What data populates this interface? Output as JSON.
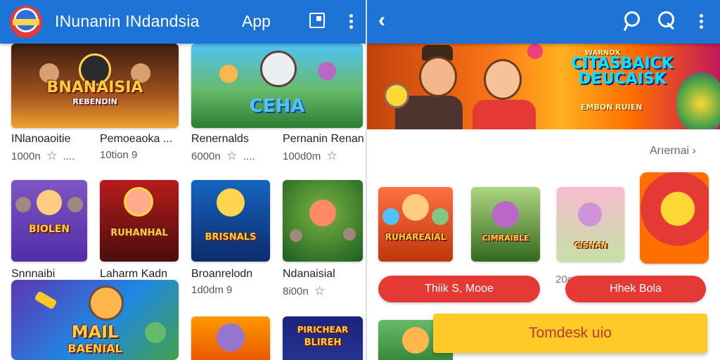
{
  "left_screen": {
    "appbar": {
      "title": "INunanin INdandsia",
      "app_label": "App",
      "logo_icon": "app-logo",
      "actions": [
        "square-icon",
        "more-vert-icon"
      ]
    },
    "grid": [
      {
        "title": "INlanoaoitie",
        "meta": "1000n",
        "icon": "star-outline",
        "extra": "...."
      },
      {
        "title": "Pemoeaoka ...",
        "meta": "10tion",
        "icon": "pin-icon",
        "extra": ""
      },
      {
        "title": "Renernalds",
        "meta": "6000n",
        "icon": "star-outline",
        "extra": "...."
      },
      {
        "title": "Pernanin Renan",
        "meta": "100d0m",
        "icon": "star-outline",
        "extra": ""
      },
      {
        "title": "Snnnaibi",
        "meta": "",
        "icon": "",
        "extra": ""
      },
      {
        "title": "Laharm Kadn",
        "meta": "",
        "icon": "",
        "extra": ""
      },
      {
        "title": "Broanrelodn",
        "meta": "1d0dm",
        "icon": "pin-icon",
        "extra": ""
      },
      {
        "title": "Ndanaisial",
        "meta": "8i00n",
        "icon": "star-outline",
        "extra": ""
      }
    ],
    "banner_texts": [
      "BNANAISIA",
      "REBENDIN",
      "CEHA",
      "BIOLEN",
      "RUHANHAL",
      "BRISNALS",
      "MAIL",
      "BAENIAL",
      "PIRICHEAR",
      "BLIREH"
    ]
  },
  "right_screen": {
    "appbar": {
      "actions": [
        "back-icon",
        "pin-icon",
        "search-icon",
        "more-vert-icon"
      ]
    },
    "featured": {
      "title": "CITASBAICK DEUCAISK",
      "title_top": "WARNOX",
      "subtitle": "EMBON RUIEN"
    },
    "section_link": "Arıernai",
    "section_chevron": "›",
    "small_label": "20c",
    "thumbs": [
      "RUHAREAIAL",
      "CIMRAIBLE",
      "CISNAN",
      ""
    ],
    "pills": [
      "Thiik S, Mooe",
      "Hhek Bola"
    ],
    "cta": "Tomdesk uio"
  },
  "colors": {
    "appbar": "#1e74d6",
    "pill": "#e53935",
    "cta": "#ffc928",
    "cta_text": "#c0392b"
  }
}
